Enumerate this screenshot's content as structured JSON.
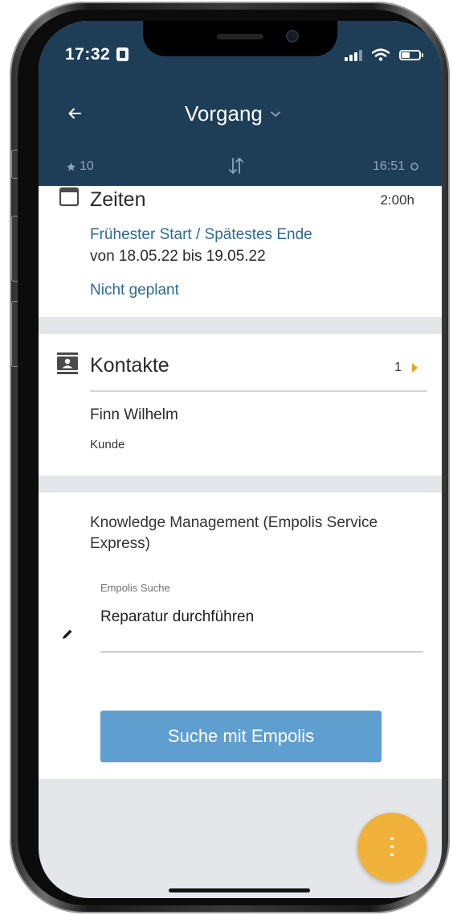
{
  "status_bar": {
    "time": "17:32"
  },
  "app_bar": {
    "title": "Vorgang",
    "star_count": "10",
    "sync_time": "16:51",
    "background_color": "#1e3e58"
  },
  "zeiten": {
    "title": "Zeiten",
    "duration": "2:00h",
    "range_label": "Frühester Start / Spätestes Ende",
    "range_value": "von 18.05.22 bis 19.05.22",
    "planning_status": "Nicht geplant"
  },
  "kontakte": {
    "title": "Kontakte",
    "count": "1",
    "contacts": [
      {
        "name": "Finn Wilhelm",
        "role": "Kunde"
      }
    ]
  },
  "knowledge": {
    "title": "Knowledge Management (Empolis Service Express)",
    "field_label": "Empolis Suche",
    "field_value": "Reparatur durchführen",
    "search_button": "Suche mit Empolis",
    "button_color": "#5f9fd0"
  },
  "fab": {
    "icon": "more-vertical-icon",
    "color": "#f0b23a"
  },
  "icons": {
    "back": "arrow-left-icon",
    "title_dropdown": "chevron-down-icon",
    "star": "star-icon",
    "sort": "sort-icon",
    "sync": "sync-icon",
    "calendar": "calendar-icon",
    "contacts": "contact-card-icon",
    "edit": "pencil-icon"
  }
}
